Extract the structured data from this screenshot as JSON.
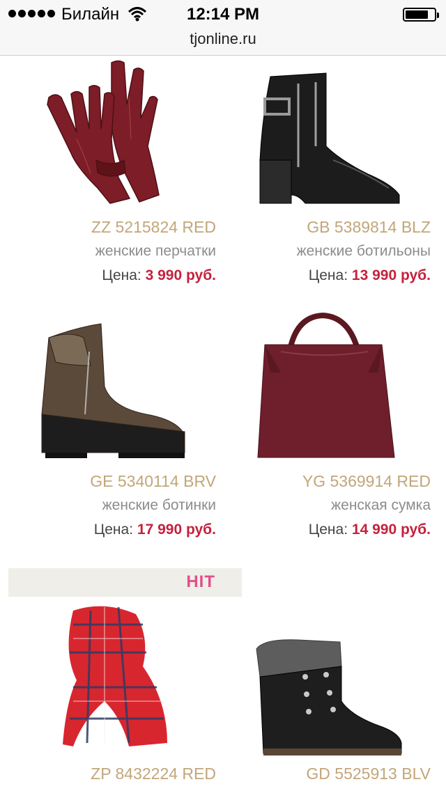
{
  "status_bar": {
    "carrier": "Билайн",
    "time": "12:14 PM",
    "battery_level": 0.8
  },
  "browser": {
    "url": "tjonline.ru"
  },
  "badge": {
    "hit_label": "HIT"
  },
  "products": [
    {
      "sku": "ZZ 5215824 RED",
      "description": "женские перчатки",
      "price_label": "Цена:",
      "price_value": "3 990 руб.",
      "icon": "gloves-icon"
    },
    {
      "sku": "GB 5389814 BLZ",
      "description": "женские ботильоны",
      "price_label": "Цена:",
      "price_value": "13 990 руб.",
      "icon": "ankle-boot-icon"
    },
    {
      "sku": "GE 5340114 BRV",
      "description": "женские ботинки",
      "price_label": "Цена:",
      "price_value": "17 990 руб.",
      "icon": "boot-icon"
    },
    {
      "sku": "YG 5369914 RED",
      "description": "женская сумка",
      "price_label": "Цена:",
      "price_value": "14 990 руб.",
      "icon": "handbag-icon"
    },
    {
      "sku": "ZP 8432224 RED",
      "icon": "scarf-icon"
    },
    {
      "sku": "GD 5525913 BLV",
      "icon": "fur-boot-icon"
    }
  ]
}
